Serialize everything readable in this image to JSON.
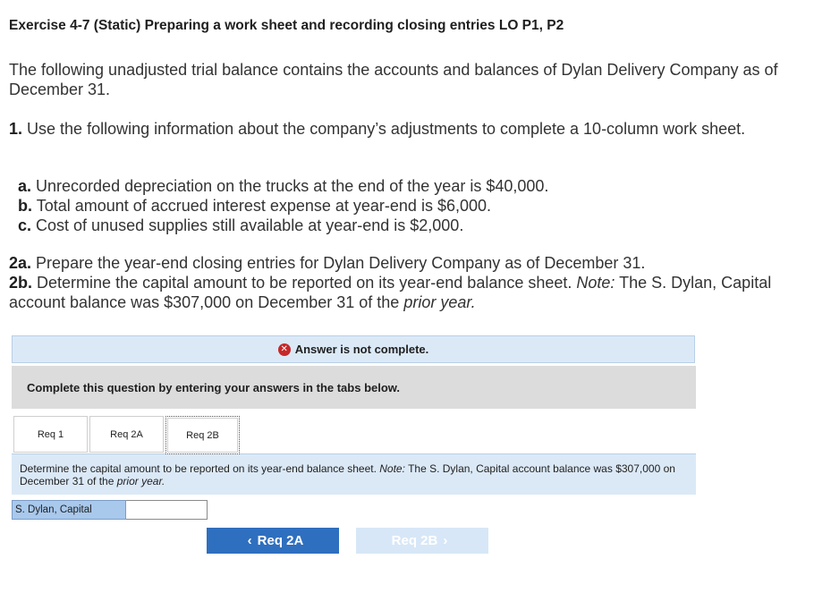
{
  "title": "Exercise 4-7 (Static) Preparing a work sheet and recording closing entries LO P1, P2",
  "intro": "The following unadjusted trial balance contains the accounts and balances of Dylan Delivery Company as of December 31.",
  "step1": {
    "num": "1.",
    "text": "Use the following information about the company’s adjustments to complete a 10-column work sheet."
  },
  "items": [
    {
      "key": "a.",
      "text": "Unrecorded depreciation on the trucks at the end of the year is $40,000."
    },
    {
      "key": "b.",
      "text": "Total amount of accrued interest expense at year-end is $6,000."
    },
    {
      "key": "c.",
      "text": "Cost of unused supplies still available at year-end is $2,000."
    }
  ],
  "step2a": {
    "num": "2a.",
    "text": "Prepare the year-end closing entries for Dylan Delivery Company as of December 31."
  },
  "step2b": {
    "num": "2b.",
    "text": "Determine the capital amount to be reported on its year-end balance sheet.",
    "note_label": "Note:",
    "note_text": "The S. Dylan, Capital account balance was $307,000 on December 31 of the",
    "note_italic": "prior year."
  },
  "status": {
    "text": "Answer is not complete.",
    "icon": "x-circle-icon",
    "icon_glyph": "✕"
  },
  "instruction": "Complete this question by entering your answers in the tabs below.",
  "tabs": [
    "Req 1",
    "Req 2A",
    "Req 2B"
  ],
  "panel": {
    "text": "Determine the capital amount to be reported on its year-end balance sheet.",
    "note_label": "Note:",
    "note_text": "The S. Dylan, Capital account balance was $307,000 on December 31 of the",
    "note_italic": "prior year."
  },
  "field": {
    "label": "S. Dylan, Capital",
    "value": ""
  },
  "buttons": {
    "prev": "Req 2A",
    "next": "Req 2B",
    "prev_glyph": "‹",
    "next_glyph": "›"
  }
}
